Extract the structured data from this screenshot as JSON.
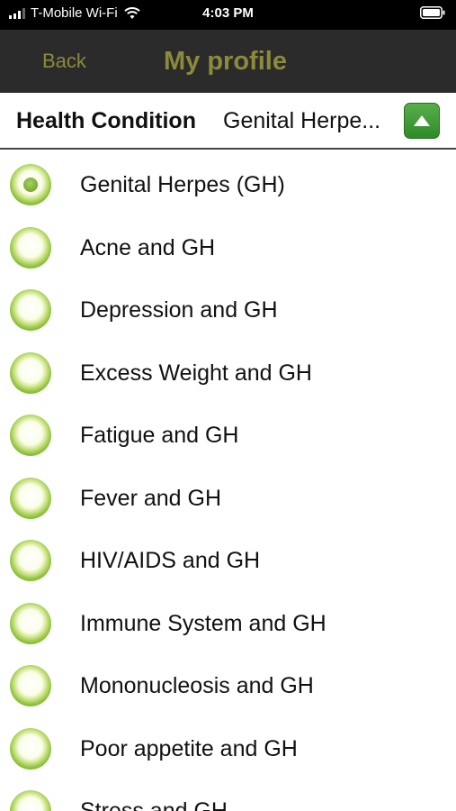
{
  "status_bar": {
    "carrier": "T-Mobile Wi-Fi",
    "time": "4:03 PM",
    "icons": [
      "signal-icon",
      "wifi-icon",
      "battery-icon"
    ]
  },
  "nav": {
    "back_label": "Back",
    "title": "My profile",
    "accent_color": "#8c8a3c"
  },
  "selector": {
    "label": "Health Condition",
    "value": "Genital Herpe...",
    "button_icon": "triangle-up-icon",
    "button_color": "#3f9a34"
  },
  "options": [
    {
      "label": "Genital Herpes (GH)",
      "selected": true
    },
    {
      "label": "Acne and GH",
      "selected": false
    },
    {
      "label": "Depression and GH",
      "selected": false
    },
    {
      "label": "Excess Weight and GH",
      "selected": false
    },
    {
      "label": "Fatigue and GH",
      "selected": false
    },
    {
      "label": "Fever and GH",
      "selected": false
    },
    {
      "label": "HIV/AIDS and GH",
      "selected": false
    },
    {
      "label": "Immune System and GH",
      "selected": false
    },
    {
      "label": "Mononucleosis and GH",
      "selected": false
    },
    {
      "label": "Poor appetite and GH",
      "selected": false
    },
    {
      "label": "Stress and GH",
      "selected": false
    }
  ]
}
